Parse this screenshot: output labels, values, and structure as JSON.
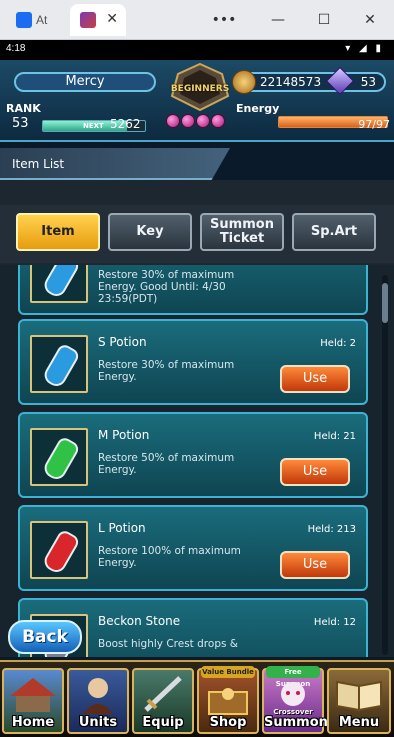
{
  "window": {
    "tabs": [
      {
        "label": "At",
        "close": ""
      },
      {
        "label": "",
        "close": "✕"
      }
    ],
    "controls": {
      "menu": "•••",
      "minimize": "—",
      "maximize": "☐",
      "close": "✕"
    }
  },
  "status_bar": {
    "time": "4:18",
    "icons": "▾ ◢ ▮"
  },
  "header": {
    "player_name": "Mercy",
    "emblem_text": "BEGINNERS",
    "gil": "22148573",
    "gems": "53",
    "rank_label": "RANK",
    "rank": "53",
    "exp_next_label": "NEXT",
    "exp_remaining": "5262",
    "exp_progress": 0.82,
    "energy_label": "Energy",
    "energy": "97/97",
    "energy_fraction": 1.0
  },
  "title": "Item List",
  "categories": [
    "Item",
    "Key",
    "Summon Ticket",
    "Sp.Art"
  ],
  "active_category": "Item",
  "items": [
    {
      "name": "",
      "held": "",
      "desc": "Restore 30% of maximum Energy. Good Until: 4/30 23:59(PDT)",
      "potion_color": "#2a9be0",
      "use_label": ""
    },
    {
      "name": "S Potion",
      "held": "Held: 2",
      "desc": "Restore 30% of maximum Energy.",
      "potion_color": "#2a9be0",
      "use_label": "Use"
    },
    {
      "name": "M Potion",
      "held": "Held: 21",
      "desc": "Restore 50% of maximum Energy.",
      "potion_color": "#2fc245",
      "use_label": "Use"
    },
    {
      "name": "L Potion",
      "held": "Held: 213",
      "desc": "Restore 100% of maximum Energy.",
      "potion_color": "#d8262b",
      "use_label": "Use"
    },
    {
      "name": "Beckon Stone",
      "held": "Held: 12",
      "desc": "Boost highly Crest drops &",
      "potion_color": "#7c7c8c",
      "use_label": ""
    }
  ],
  "back_label": "Back",
  "nav": [
    {
      "label": "Home",
      "badge": "",
      "sub": ""
    },
    {
      "label": "Units",
      "badge": "",
      "sub": ""
    },
    {
      "label": "Equip",
      "badge": "",
      "sub": ""
    },
    {
      "label": "Shop",
      "badge": "Value Bundle",
      "sub": ""
    },
    {
      "label": "Summon",
      "badge": "Free Summon",
      "sub": "Crossover"
    },
    {
      "label": "Menu",
      "badge": "",
      "sub": ""
    }
  ]
}
